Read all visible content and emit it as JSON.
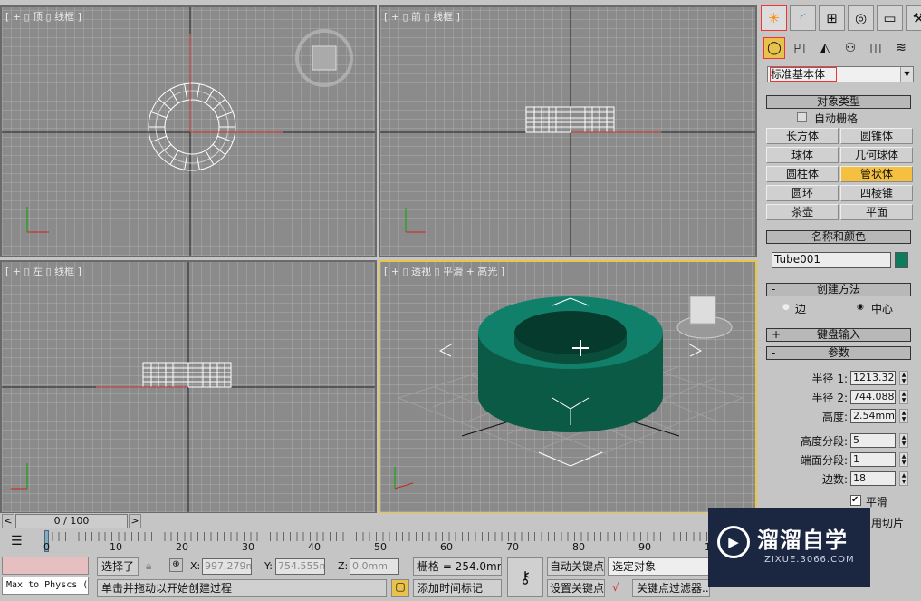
{
  "viewports": {
    "top": {
      "label": "[ + ▯ 顶 ▯ 线框 ]"
    },
    "front": {
      "label": "[ + ▯ 前 ▯ 线框 ]"
    },
    "left": {
      "label": "[ + ▯ 左 ▯ 线框 ]"
    },
    "perspective": {
      "label": "[ + ▯ 透视 ▯ 平滑 + 高光 ]"
    }
  },
  "panel": {
    "tabs": [
      "create-icon",
      "modify-icon",
      "hierarchy-icon",
      "motion-icon",
      "display-icon",
      "utilities-icon"
    ],
    "category": "标准基本体",
    "object_type": {
      "title": "对象类型",
      "auto_grid": "自动栅格",
      "buttons": [
        "长方体",
        "圆锥体",
        "球体",
        "几何球体",
        "圆柱体",
        "管状体",
        "圆环",
        "四棱锥",
        "茶壶",
        "平面"
      ],
      "selected": "管状体"
    },
    "name_color": {
      "title": "名称和颜色",
      "name": "Tube001",
      "color": "#0e7a5e"
    },
    "creation_method": {
      "title": "创建方法",
      "options": [
        "边",
        "中心"
      ],
      "selected": "中心"
    },
    "keyboard_entry": {
      "title": "键盘输入"
    },
    "parameters": {
      "title": "参数",
      "radius1_label": "半径 1:",
      "radius1": "1213.32m",
      "radius2_label": "半径 2:",
      "radius2": "744.088m",
      "height_label": "高度:",
      "height": "2.54mm",
      "height_segs_label": "高度分段:",
      "height_segs": "5",
      "cap_segs_label": "端面分段:",
      "cap_segs": "1",
      "sides_label": "边数:",
      "sides": "18",
      "smooth_label": "平滑",
      "slice_label": "用切片"
    }
  },
  "timeline": {
    "position": "0 / 100",
    "prev": "<",
    "next": ">",
    "ticks": [
      "0",
      "10",
      "20",
      "30",
      "40",
      "50",
      "60",
      "70",
      "80",
      "90",
      "100"
    ]
  },
  "status": {
    "script_listener": "Max to Physcs (",
    "selected": "选择了",
    "x_label": "X:",
    "x": "997.279mm",
    "y_label": "Y:",
    "y": "754.555mm",
    "z_label": "Z:",
    "z": "0.0mm",
    "grid": "栅格 = 254.0mm",
    "prompt": "单击并拖动以开始创建过程",
    "add_time_tag": "添加时间标记",
    "auto_key": "自动关键点",
    "set_key": "设置关键点",
    "key_mode": "选定对象",
    "key_filters": "关键点过滤器...",
    "frame": "0"
  },
  "watermark": {
    "title": "溜溜自学",
    "url": "ZIXUE.3066.COM"
  }
}
